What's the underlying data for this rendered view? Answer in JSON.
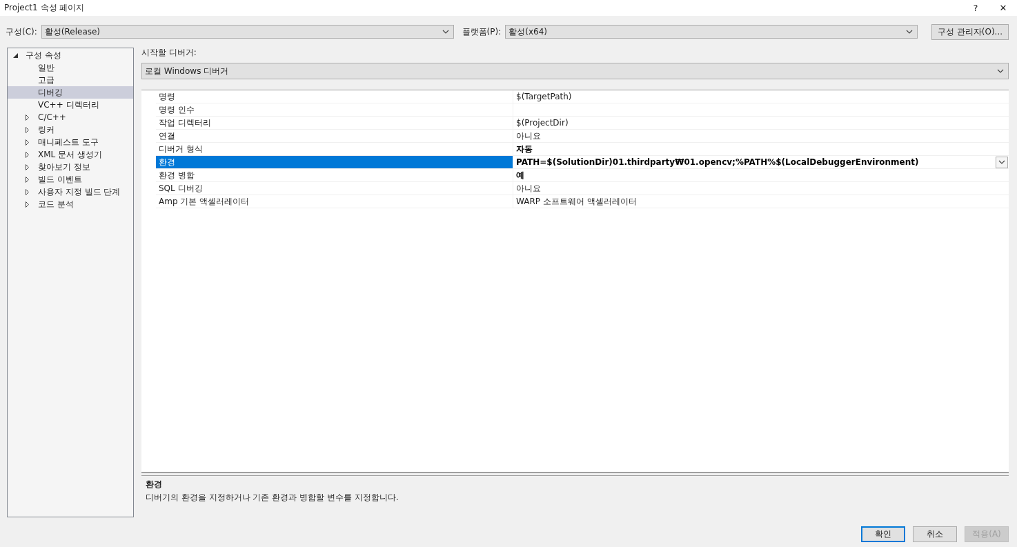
{
  "window": {
    "title": "Project1 속성 페이지",
    "help": "?",
    "close": "✕"
  },
  "config": {
    "label": "구성(C):",
    "value": "활성(Release)"
  },
  "platform": {
    "label": "플랫폼(P):",
    "value": "활성(x64)"
  },
  "config_manager_button": "구성 관리자(O)...",
  "tree": [
    {
      "label": "구성 속성",
      "expanded": true,
      "selected": false,
      "children": [
        {
          "label": "일반",
          "selected": false
        },
        {
          "label": "고급",
          "selected": false
        },
        {
          "label": "디버깅",
          "selected": true
        },
        {
          "label": "VC++ 디렉터리",
          "selected": false
        },
        {
          "label": "C/C++",
          "selected": false,
          "expanded": false
        },
        {
          "label": "링커",
          "selected": false,
          "expanded": false
        },
        {
          "label": "매니페스트 도구",
          "selected": false,
          "expanded": false
        },
        {
          "label": "XML 문서 생성기",
          "selected": false,
          "expanded": false
        },
        {
          "label": "찾아보기 정보",
          "selected": false,
          "expanded": false
        },
        {
          "label": "빌드 이벤트",
          "selected": false,
          "expanded": false
        },
        {
          "label": "사용자 지정 빌드 단계",
          "selected": false,
          "expanded": false
        },
        {
          "label": "코드 분석",
          "selected": false,
          "expanded": false
        }
      ]
    }
  ],
  "debugger": {
    "label": "시작할 디버거:",
    "value": "로컬 Windows 디버거"
  },
  "properties": [
    {
      "name": "명령",
      "value": "$(TargetPath)",
      "selected": false,
      "modified": false
    },
    {
      "name": "명령 인수",
      "selected": false
    },
    {
      "name": "작업 디렉터리",
      "value": "$(ProjectDir)",
      "selected": false,
      "modified": false
    },
    {
      "name": "연결",
      "value": "아니요",
      "selected": false,
      "modified": false
    },
    {
      "name": "디버거 형식",
      "value": "자동",
      "selected": false,
      "modified": true
    },
    {
      "name": "환경",
      "value": "PATH=$(SolutionDir)01.thirdparty₩01.opencv;%PATH%$(LocalDebuggerEnvironment)",
      "selected": true,
      "modified": true
    },
    {
      "name": "환경 병합",
      "value": "예",
      "selected": false,
      "modified": true
    },
    {
      "name": "SQL 디버깅",
      "value": "아니요",
      "selected": false,
      "modified": false
    },
    {
      "name": "Amp 기본 액셀러레이터",
      "value": "WARP 소프트웨어 액셀러레이터",
      "selected": false,
      "modified": false
    }
  ],
  "description": {
    "title": "환경",
    "text": "디버기의 환경을 지정하거나 기존 환경과 병합할 변수를 지정합니다."
  },
  "buttons": [
    {
      "label": "확인",
      "kind": "default",
      "disabled": false
    },
    {
      "label": "취소",
      "kind": "normal",
      "disabled": false
    },
    {
      "label": "적용(A)",
      "kind": "normal",
      "disabled": true
    }
  ]
}
